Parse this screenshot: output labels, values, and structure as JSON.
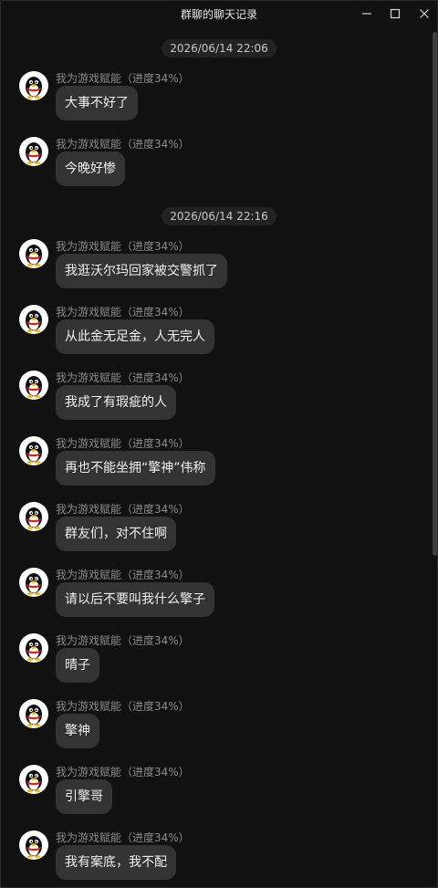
{
  "window": {
    "title": "群聊的聊天记录"
  },
  "sender_name": "我为游戏赋能（进度34%）",
  "sections": [
    {
      "timestamp": "2026/06/14 22:06",
      "messages": [
        "大事不好了",
        "今晚好惨"
      ]
    },
    {
      "timestamp": "2026/06/14 22:16",
      "messages": [
        "我逛沃尔玛回家被交警抓了",
        "从此金无足金，人无完人",
        "我成了有瑕疵的人",
        "再也不能坐拥“擎神”伟称",
        "群友们，对不住啊",
        "请以后不要叫我什么擎子",
        "晴子",
        "擎神",
        "引擎哥",
        "我有案底，我不配"
      ]
    }
  ]
}
